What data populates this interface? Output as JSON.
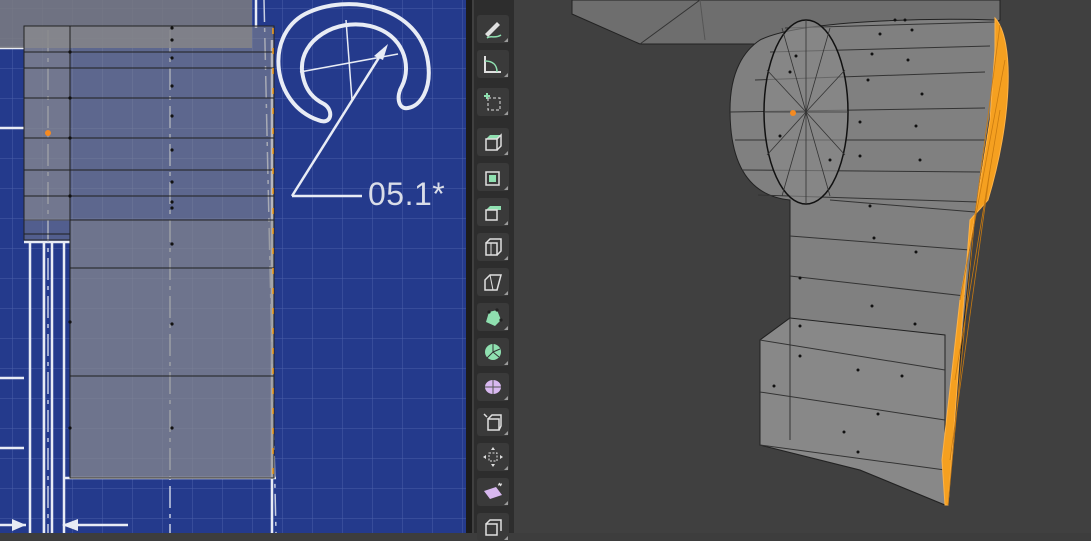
{
  "left_viewport": {
    "dimension_label": "05.1*"
  },
  "toolbar": {
    "tools": [
      {
        "name": "annotate",
        "icon": "annotate-icon"
      },
      {
        "name": "measure",
        "icon": "measure-icon"
      },
      {
        "name": "add-cube",
        "icon": "add-cube-icon"
      },
      {
        "name": "extrude-region",
        "icon": "extrude-region-icon"
      },
      {
        "name": "inset-faces",
        "icon": "inset-faces-icon"
      },
      {
        "name": "bevel",
        "icon": "bevel-icon"
      },
      {
        "name": "loop-cut",
        "icon": "loop-cut-icon"
      },
      {
        "name": "knife",
        "icon": "knife-icon"
      },
      {
        "name": "poly-build",
        "icon": "poly-build-icon"
      },
      {
        "name": "spin",
        "icon": "spin-icon"
      },
      {
        "name": "smooth",
        "icon": "smooth-icon"
      },
      {
        "name": "edge-slide",
        "icon": "edge-slide-icon"
      },
      {
        "name": "shrink-fatten",
        "icon": "shrink-fatten-icon"
      },
      {
        "name": "shear",
        "icon": "shear-icon"
      },
      {
        "name": "rip-region",
        "icon": "rip-region-icon"
      }
    ]
  },
  "colors": {
    "blueprint": "#243a8c",
    "selection": "#f5a020",
    "viewport_bg": "#404040",
    "toolbar_bg": "#2d2d2d",
    "tool_icon_green": "#8fe0b0",
    "tool_icon_purple": "#d8b8f0"
  }
}
